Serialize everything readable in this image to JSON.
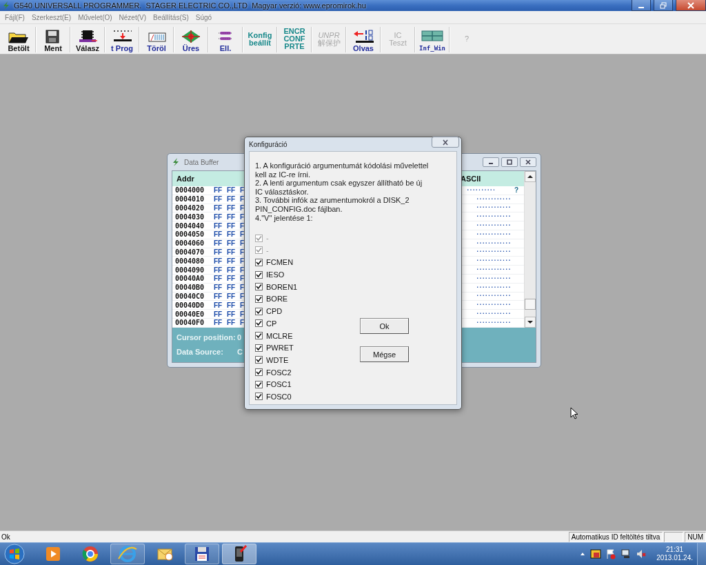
{
  "window": {
    "title": "G540 UNIVERSALL PROGRAMMER.  STAGER ELECTRIC CO.,LTD  Magyar verzió: www.epromirok.hu"
  },
  "menu": [
    "Fájl(F)",
    "Szerkeszt(E)",
    "Művelet(O)",
    "Nézet(V)",
    "Beállítás(S)",
    "Súgó"
  ],
  "toolbar": [
    {
      "kind": "icon",
      "label": "Betölt",
      "disabled": false
    },
    {
      "kind": "icon",
      "label": "Ment",
      "disabled": false
    },
    {
      "kind": "icon",
      "label": "Válasz",
      "disabled": false
    },
    {
      "kind": "icon",
      "label": "t Prog",
      "disabled": false
    },
    {
      "kind": "icon",
      "label": "Töröl",
      "disabled": false
    },
    {
      "kind": "icon",
      "label": "Üres",
      "disabled": false
    },
    {
      "kind": "icon",
      "label": "Ell.",
      "disabled": false
    },
    {
      "kind": "text",
      "label": "Konfig\nbeállít",
      "disabled": false
    },
    {
      "kind": "text",
      "label": "ENCR\nCONF\nPRTE",
      "disabled": false
    },
    {
      "kind": "text",
      "label": "*UNPR*\n解保护",
      "disabled": true
    },
    {
      "kind": "icon",
      "label": "Olvas",
      "disabled": false
    },
    {
      "kind": "text",
      "label": "IC\nTeszt",
      "disabled": true
    },
    {
      "kind": "icon",
      "label": "Inf_Win",
      "disabled": false
    },
    {
      "kind": "text",
      "label": "?",
      "disabled": true
    }
  ],
  "data_buffer": {
    "title": "Data Buffer",
    "columns": [
      "Addr",
      "ASCII"
    ],
    "rows": [
      {
        "addr": "0004000",
        "hex": [
          "FF",
          "FF",
          "F"
        ],
        "ascii": "..........",
        "flag": "?"
      },
      {
        "addr": "0004010",
        "hex": [
          "FF",
          "FF",
          "F"
        ],
        "ascii": "............"
      },
      {
        "addr": "0004020",
        "hex": [
          "FF",
          "FF",
          "F"
        ],
        "ascii": "............"
      },
      {
        "addr": "0004030",
        "hex": [
          "FF",
          "FF",
          "F"
        ],
        "ascii": "............"
      },
      {
        "addr": "0004040",
        "hex": [
          "FF",
          "FF",
          "F"
        ],
        "ascii": "............"
      },
      {
        "addr": "0004050",
        "hex": [
          "FF",
          "FF",
          "F"
        ],
        "ascii": "............"
      },
      {
        "addr": "0004060",
        "hex": [
          "FF",
          "FF",
          "F"
        ],
        "ascii": "............"
      },
      {
        "addr": "0004070",
        "hex": [
          "FF",
          "FF",
          "F"
        ],
        "ascii": "............"
      },
      {
        "addr": "0004080",
        "hex": [
          "FF",
          "FF",
          "F"
        ],
        "ascii": "............"
      },
      {
        "addr": "0004090",
        "hex": [
          "FF",
          "FF",
          "F"
        ],
        "ascii": "............"
      },
      {
        "addr": "00040A0",
        "hex": [
          "FF",
          "FF",
          "F"
        ],
        "ascii": "............"
      },
      {
        "addr": "00040B0",
        "hex": [
          "FF",
          "FF",
          "F"
        ],
        "ascii": "............"
      },
      {
        "addr": "00040C0",
        "hex": [
          "FF",
          "FF",
          "F"
        ],
        "ascii": "............"
      },
      {
        "addr": "00040D0",
        "hex": [
          "FF",
          "FF",
          "F"
        ],
        "ascii": "............"
      },
      {
        "addr": "00040E0",
        "hex": [
          "FF",
          "FF",
          "F"
        ],
        "ascii": "............"
      },
      {
        "addr": "00040F0",
        "hex": [
          "FF",
          "FF",
          "F"
        ],
        "ascii": "............"
      }
    ],
    "footer": [
      {
        "label": "Cursor position:",
        "value": "0"
      },
      {
        "label": "Data Source:",
        "value": "C"
      }
    ]
  },
  "dialog": {
    "title": "Konfiguráció",
    "text": "1. A konfiguráció argumentumát kódolási művelettel\nkell az IC-re írni.\n2. A lenti argumentum csak egyszer állítható be új\nIC választáskor.\n3. További infók az arumentumokról a DISK_2\nPIN_CONFIG.doc fájlban.\n4.\"V\" jelentése 1:",
    "options": [
      {
        "label": "-",
        "checked": true,
        "disabled": true
      },
      {
        "label": "-",
        "checked": true,
        "disabled": true
      },
      {
        "label": "FCMEN",
        "checked": true,
        "disabled": false
      },
      {
        "label": "IESO",
        "checked": true,
        "disabled": false
      },
      {
        "label": "BOREN1",
        "checked": true,
        "disabled": false
      },
      {
        "label": "BORE",
        "checked": true,
        "disabled": false
      },
      {
        "label": "CPD",
        "checked": true,
        "disabled": false
      },
      {
        "label": "CP",
        "checked": true,
        "disabled": false
      },
      {
        "label": "MCLRE",
        "checked": true,
        "disabled": false
      },
      {
        "label": "PWRET",
        "checked": true,
        "disabled": false
      },
      {
        "label": "WDTE",
        "checked": true,
        "disabled": false
      },
      {
        "label": "FOSC2",
        "checked": true,
        "disabled": false
      },
      {
        "label": "FOSC1",
        "checked": true,
        "disabled": false
      },
      {
        "label": "FOSC0",
        "checked": true,
        "disabled": false
      }
    ],
    "buttons": [
      "Ok",
      "Mégse"
    ]
  },
  "status_bar": {
    "message": "Ok",
    "panes": [
      "Automatikus ID feltöltés tiltva",
      "NUM"
    ]
  },
  "taskbar": {
    "time": "21:31",
    "date": "2013.01.24."
  }
}
